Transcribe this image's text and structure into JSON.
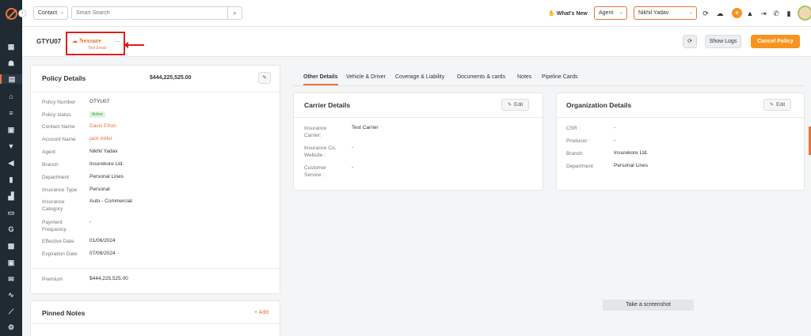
{
  "topbar": {
    "contact_select": "Contact",
    "search_placeholder": "Smart Search",
    "whats_new": "What's New",
    "role_select": "Agent",
    "user_select": "Nikhil Yadav"
  },
  "header": {
    "policy_id": "GTYU07",
    "carrier_logo_text": "Nexsure",
    "carrier_logo_sub": "Test Email",
    "more": "...",
    "show_logs": "Show Logs",
    "cancel_policy": "Cancel Policy"
  },
  "policy_details": {
    "title": "Policy Details",
    "amount": "$444,225,525.00",
    "rows": [
      {
        "label": "Policy Number",
        "value": "GTYU07"
      },
      {
        "label": "Policy status",
        "value": "Active"
      },
      {
        "label": "Contact Name",
        "value": "Davis Efron"
      },
      {
        "label": "Account Name",
        "value": "jack miller"
      },
      {
        "label": "Agent",
        "value": "Nikhil Yadav"
      },
      {
        "label": "Branch",
        "value": "Insurekore Ltd."
      },
      {
        "label": "Department",
        "value": "Personal Lines"
      },
      {
        "label": "Insurance Type",
        "value": "Personal"
      },
      {
        "label": "Insurance Category",
        "value": "Auto - Commercial"
      },
      {
        "label": "Payment Frequency",
        "value": "-"
      },
      {
        "label": "Effective Date",
        "value": "01/06/2024"
      },
      {
        "label": "Expiration Date",
        "value": "07/08/2024"
      }
    ],
    "premium_label": "Premium",
    "premium_value": "$444,225,525.00"
  },
  "pinned_notes": {
    "title": "Pinned Notes",
    "add": "+ Add"
  },
  "tabs": [
    "Other Details",
    "Vehicle & Driver",
    "Coverage & Liability",
    "Documents & cards",
    "Notes",
    "Pipeline Cards"
  ],
  "carrier_details": {
    "title": "Carrier Details",
    "edit": "Edit",
    "rows": [
      {
        "label": "Insurance Carrier:",
        "value": "Test Carrier"
      },
      {
        "label": "Insurance Co. Website :",
        "value": "-"
      },
      {
        "label": "Customer Service :",
        "value": "-"
      }
    ]
  },
  "organization_details": {
    "title": "Organization Details",
    "edit": "Edit",
    "rows": [
      {
        "label": "CSR :",
        "value": "-"
      },
      {
        "label": "Producer :",
        "value": "-"
      },
      {
        "label": "Branch",
        "value": "Insurekore Ltd."
      },
      {
        "label": "Department",
        "value": "Personal Lines"
      }
    ]
  },
  "overlay": {
    "screenshot": "Take a screenshot"
  },
  "colors": {
    "accent": "#f7931e",
    "sidebar": "#1f2a33",
    "highlight_box": "#e01e1e"
  }
}
